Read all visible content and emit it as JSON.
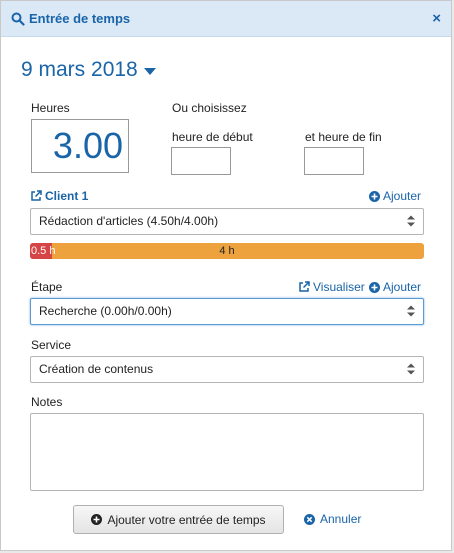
{
  "header": {
    "title": "Entrée de temps",
    "search_icon": "search-icon",
    "close_label": "×"
  },
  "date": {
    "label": "9 mars 2018"
  },
  "hours": {
    "label": "Heures",
    "value": "3.00"
  },
  "choose": {
    "label": "Ou choisissez",
    "start_label": "heure de début",
    "end_label": "et heure de fin"
  },
  "client": {
    "label": "Client 1",
    "add_label": "Ajouter",
    "selected": "Rédaction d'articles (4.50h/4.00h)"
  },
  "progress": {
    "over_label": "0.5 h",
    "main_label": "4 h",
    "over_fraction": 0.055,
    "colors": {
      "over": "#d64545",
      "main": "#eea23d"
    }
  },
  "step": {
    "label": "Étape",
    "view_label": "Visualiser",
    "add_label": "Ajouter",
    "selected": "Recherche (0.00h/0.00h)"
  },
  "service": {
    "label": "Service",
    "selected": "Création de contenus"
  },
  "notes": {
    "label": "Notes",
    "value": ""
  },
  "actions": {
    "submit_label": "Ajouter votre entrée de temps",
    "cancel_label": "Annuler"
  },
  "colors": {
    "accent": "#1a64a8",
    "header_bg": "#dbe9f7"
  }
}
